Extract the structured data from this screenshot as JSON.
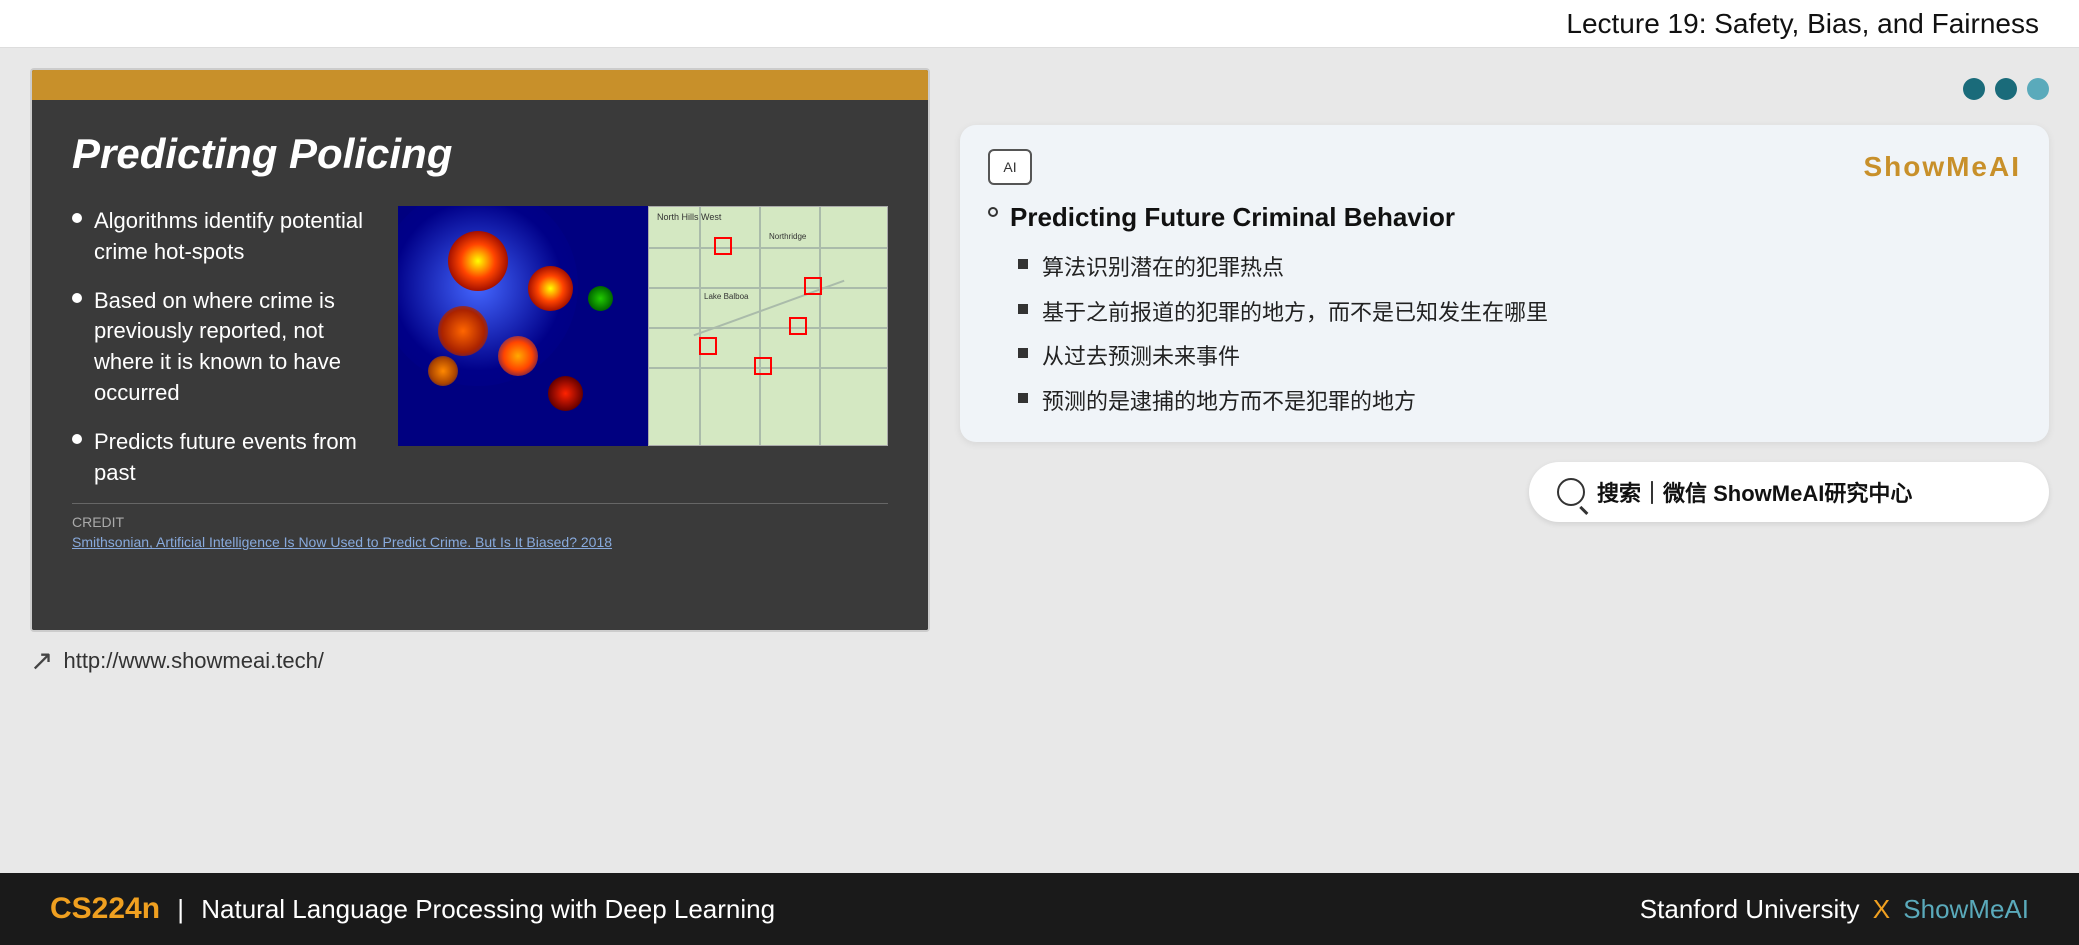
{
  "topbar": {
    "title": "Lecture 19: Safety, Bias, and Fairness"
  },
  "slide": {
    "title": "Predicting Policing",
    "bullets": [
      "Algorithms identify potential crime hot-spots",
      "Based on where crime is previously reported, not where it is known to have occurred",
      "Predicts future events from past"
    ],
    "credit_label": "CREDIT",
    "credit_link": "Smithsonian, Artificial Intelligence Is Now Used to Predict Crime. But Is It Biased?  2018"
  },
  "url": {
    "text": "http://www.showmeai.tech/"
  },
  "card": {
    "brand": "ShowMeAI",
    "main_bullet": "Predicting Future Criminal Behavior",
    "sub_bullets": [
      "算法识别潜在的犯罪热点",
      "基于之前报道的犯罪的地方，而不是已知发生在哪里",
      "从过去预测未来事件",
      "预测的是逮捕的地方而不是犯罪的地方"
    ],
    "ai_icon_text": "AI"
  },
  "search": {
    "text": "搜索｜微信 ShowMeAI研究中心"
  },
  "bottom": {
    "course_code": "CS224n",
    "divider": "|",
    "course_name": "Natural Language Processing with Deep Learning",
    "university": "Stanford University",
    "x_symbol": "X",
    "showmeai": "ShowMeAI"
  },
  "nav_dots": [
    {
      "state": "active"
    },
    {
      "state": "active"
    },
    {
      "state": "inactive"
    }
  ]
}
